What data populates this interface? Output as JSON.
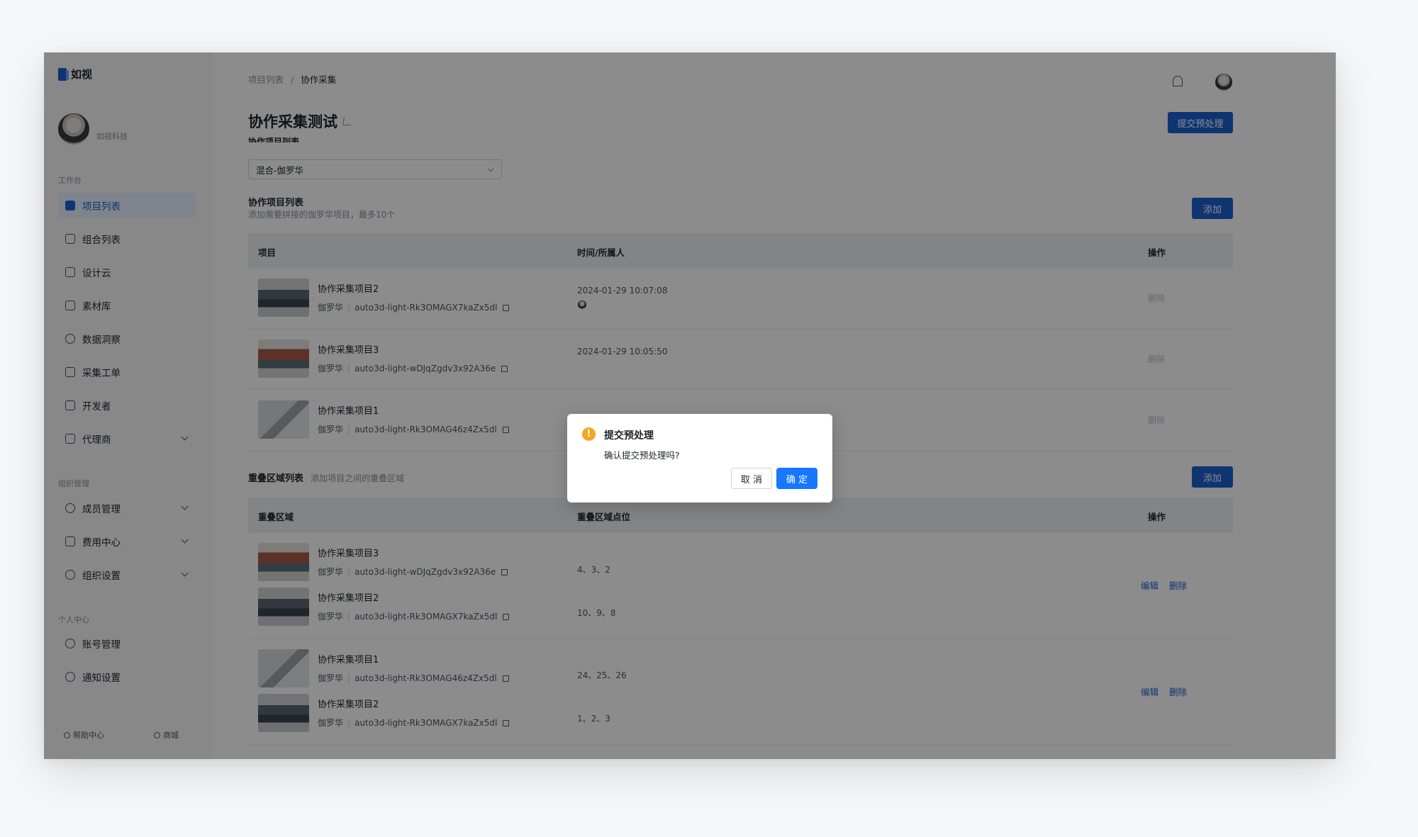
{
  "app": {
    "logo_text": "如视"
  },
  "profile": {
    "org_name": "如视科技"
  },
  "sidebar": {
    "section_work": "工作台",
    "section_org": "组织管理",
    "section_personal": "个人中心",
    "items": [
      {
        "label": "项目列表",
        "icon": "project-list-icon",
        "active": true
      },
      {
        "label": "组合列表",
        "icon": "layers-icon"
      },
      {
        "label": "设计云",
        "icon": "monitor-icon"
      },
      {
        "label": "素材库",
        "icon": "folder-icon"
      },
      {
        "label": "数据洞察",
        "icon": "pie-chart-icon"
      },
      {
        "label": "采集工单",
        "icon": "document-icon"
      },
      {
        "label": "开发者",
        "icon": "code-icon"
      },
      {
        "label": "代理商",
        "icon": "briefcase-icon"
      },
      {
        "label": "成员管理",
        "icon": "members-icon"
      },
      {
        "label": "费用中心",
        "icon": "wallet-icon"
      },
      {
        "label": "组织设置",
        "icon": "settings-icon"
      },
      {
        "label": "账号管理",
        "icon": "user-icon"
      },
      {
        "label": "通知设置",
        "icon": "notification-settings-icon"
      }
    ],
    "footer": {
      "help": "帮助中心",
      "shop": "商城"
    }
  },
  "header": {
    "breadcrumb_root": "项目列表",
    "breadcrumb_sep": "/",
    "breadcrumb_current": "协作采集"
  },
  "page": {
    "title": "协作采集测试",
    "submit_label": "提交预处理",
    "sub_label": "协作项目列表",
    "select_value": "混合-伽罗华"
  },
  "collab_section": {
    "title": "协作项目列表",
    "desc": "添加需要拼接的伽罗华项目，最多10个",
    "add_label": "添加",
    "columns": [
      "项目",
      "时间/所属人",
      "操作"
    ],
    "rows": [
      {
        "name": "协作采集项目2",
        "owner": "伽罗华",
        "code": "auto3d-light-Rk3OMAGX7kaZx5dl",
        "time": "2024-01-29 10:07:08",
        "action": "删除"
      },
      {
        "name": "协作采集项目3",
        "owner": "伽罗华",
        "code": "auto3d-light-wDJqZgdv3x92A36e",
        "time": "2024-01-29 10:05:50",
        "action": "删除"
      },
      {
        "name": "协作采集项目1",
        "owner": "伽罗华",
        "code": "auto3d-light-Rk3OMAG46z4Zx5dl",
        "time": "",
        "action": "删除"
      }
    ]
  },
  "overlap_section": {
    "title": "重叠区域列表",
    "desc": "添加项目之间的重叠区域",
    "add_label": "添加",
    "columns": [
      "重叠区域",
      "重叠区域点位",
      "操作"
    ],
    "edit_label": "编辑",
    "delete_label": "删除",
    "groups": [
      {
        "items": [
          {
            "name": "协作采集项目3",
            "owner": "伽罗华",
            "code": "auto3d-light-wDJqZgdv3x92A36e",
            "points": "4、3、2"
          },
          {
            "name": "协作采集项目2",
            "owner": "伽罗华",
            "code": "auto3d-light-Rk3OMAGX7kaZx5dl",
            "points": "10、9、8"
          }
        ]
      },
      {
        "items": [
          {
            "name": "协作采集项目1",
            "owner": "伽罗华",
            "code": "auto3d-light-Rk3OMAG46z4Zx5dl",
            "points": "24、25、26"
          },
          {
            "name": "协作采集项目2",
            "owner": "伽罗华",
            "code": "auto3d-light-Rk3OMAGX7kaZx5dl",
            "points": "1、2、3"
          }
        ]
      }
    ]
  },
  "modal": {
    "title": "提交预处理",
    "body": "确认提交预处理吗?",
    "cancel_label": "取 消",
    "ok_label": "确 定",
    "icon_glyph": "!"
  },
  "colors": {
    "accent": "#1a5fd0",
    "modal_ok": "#1677ff",
    "warning": "#f5a623"
  }
}
